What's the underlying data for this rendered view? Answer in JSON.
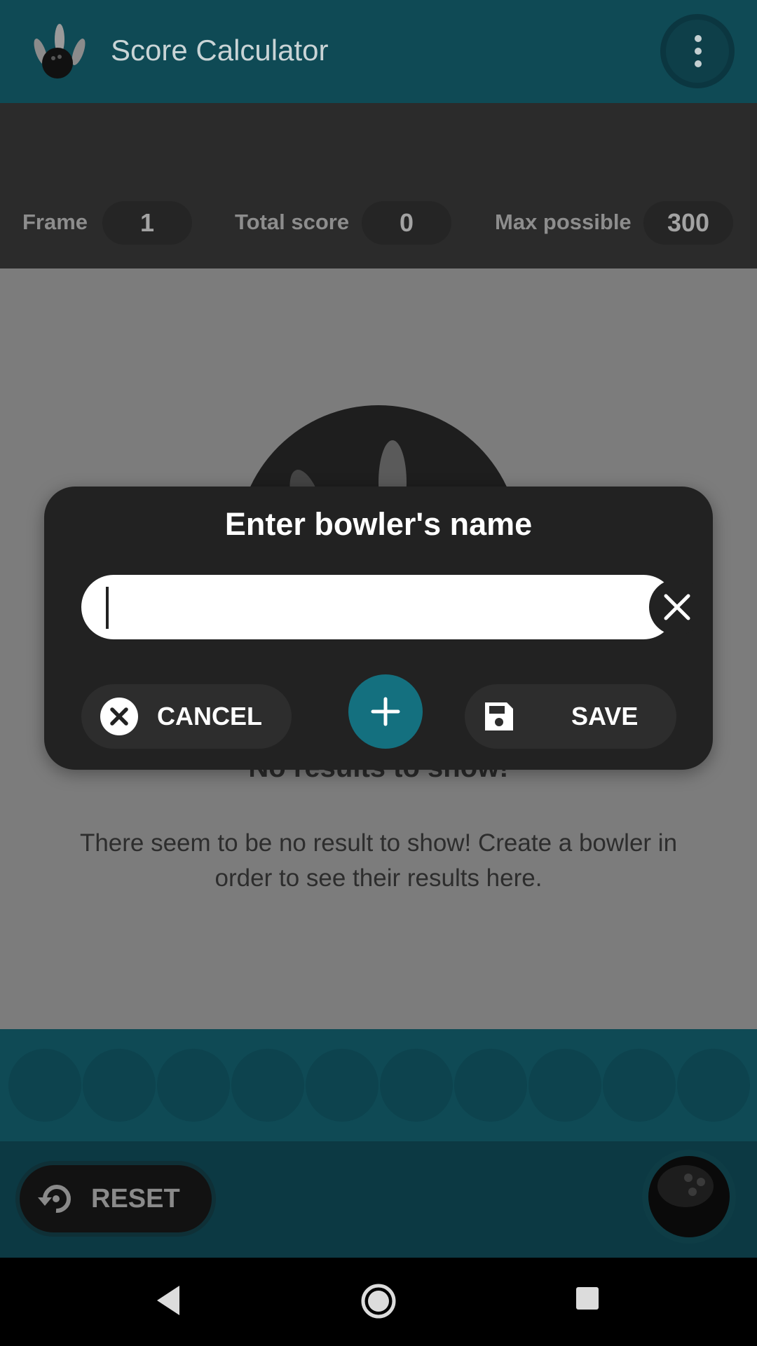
{
  "app": {
    "title": "Score Calculator"
  },
  "stats": {
    "frame_label": "Frame",
    "frame_value": "1",
    "total_label": "Total score",
    "total_value": "0",
    "max_label": "Max possible",
    "max_value": "300"
  },
  "empty_state": {
    "title": "No results to show!",
    "message": "There seem to be no result to show! Create a bowler in order to see their results here."
  },
  "dialog": {
    "title": "Enter bowler's name",
    "input_value": "",
    "cancel_label": "CANCEL",
    "save_label": "SAVE"
  },
  "actions": {
    "reset_label": "RESET"
  },
  "colors": {
    "app_bar": "#0f4a55",
    "accent": "#14707f",
    "dialog_bg": "#222222"
  },
  "icons": [
    "bowling-pins-logo-icon",
    "more-vert-icon",
    "close-icon",
    "cancel-circle-icon",
    "plus-icon",
    "save-icon",
    "reset-icon",
    "bowling-ball-icon",
    "nav-back-icon",
    "nav-home-icon",
    "nav-recents-icon"
  ]
}
